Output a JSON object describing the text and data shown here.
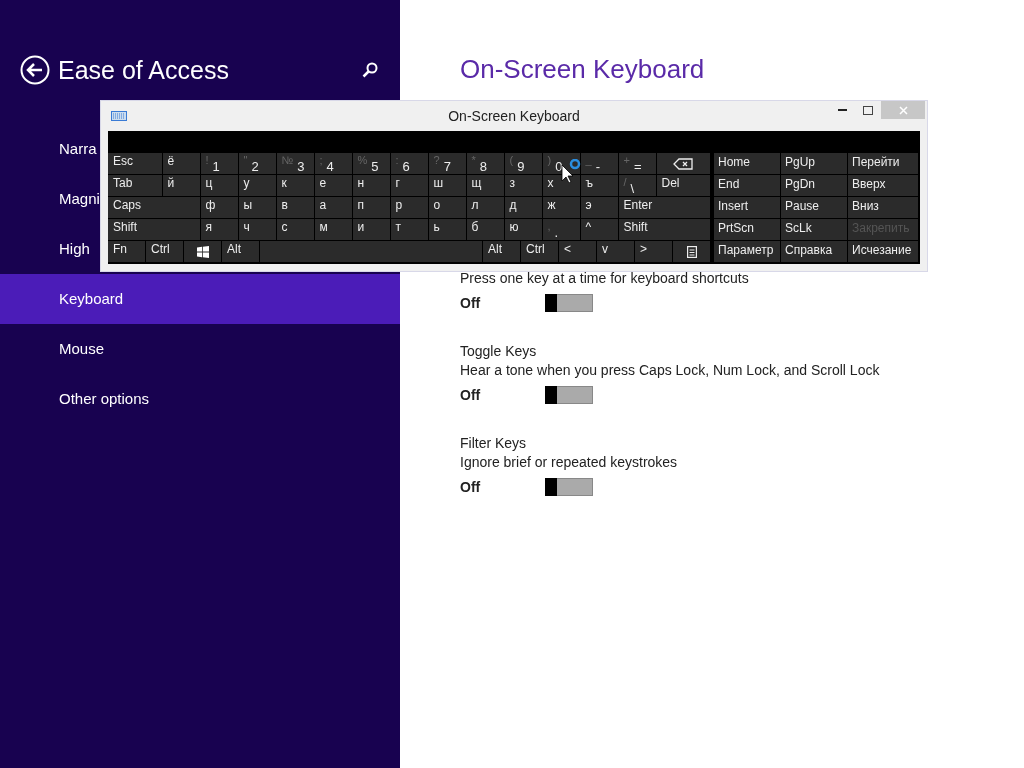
{
  "sidebar": {
    "title": "Ease of Access",
    "items": [
      {
        "label": "Narra",
        "selected": false
      },
      {
        "label": "Magni",
        "selected": false
      },
      {
        "label": "High",
        "selected": false
      },
      {
        "label": "Keyboard",
        "selected": true
      },
      {
        "label": "Mouse",
        "selected": false
      },
      {
        "label": "Other options",
        "selected": false
      }
    ]
  },
  "content": {
    "heading": "On-Screen Keyboard",
    "settings": [
      {
        "description": "Press one key at a time for keyboard shortcuts",
        "value": "Off",
        "on": false
      },
      {
        "title": "Toggle Keys",
        "description": "Hear a tone when you press Caps Lock, Num Lock, and Scroll Lock",
        "value": "Off",
        "on": false
      },
      {
        "title": "Filter Keys",
        "description": "Ignore brief or repeated keystrokes",
        "value": "Off",
        "on": false
      }
    ]
  },
  "osk": {
    "title": "On-Screen Keyboard",
    "rows": [
      [
        {
          "kind": "mod",
          "label": "Esc"
        },
        {
          "kind": "char",
          "label": "ё"
        },
        {
          "kind": "char",
          "shift": "!",
          "label": "1"
        },
        {
          "kind": "char",
          "shift": "\"",
          "label": "2"
        },
        {
          "kind": "char",
          "shift": "№",
          "label": "3"
        },
        {
          "kind": "char",
          "shift": ";",
          "label": "4"
        },
        {
          "kind": "char",
          "shift": "%",
          "label": "5"
        },
        {
          "kind": "char",
          "shift": ":",
          "label": "6"
        },
        {
          "kind": "char",
          "shift": "?",
          "label": "7"
        },
        {
          "kind": "char",
          "shift": "*",
          "label": "8"
        },
        {
          "kind": "char",
          "shift": "(",
          "label": "9"
        },
        {
          "kind": "char",
          "shift": ")",
          "label": "0"
        },
        {
          "kind": "char",
          "shift": "_",
          "label": "-"
        },
        {
          "kind": "char",
          "shift": "+",
          "label": "="
        },
        {
          "kind": "backspace"
        }
      ],
      [
        {
          "kind": "mod",
          "label": "Tab"
        },
        {
          "kind": "char",
          "label": "й"
        },
        {
          "kind": "char",
          "label": "ц"
        },
        {
          "kind": "char",
          "label": "у"
        },
        {
          "kind": "char",
          "label": "к"
        },
        {
          "kind": "char",
          "label": "е"
        },
        {
          "kind": "char",
          "label": "н"
        },
        {
          "kind": "char",
          "label": "г"
        },
        {
          "kind": "char",
          "label": "ш"
        },
        {
          "kind": "char",
          "label": "щ"
        },
        {
          "kind": "char",
          "label": "з"
        },
        {
          "kind": "char",
          "label": "х"
        },
        {
          "kind": "char",
          "label": "ъ"
        },
        {
          "kind": "char",
          "shift": "/",
          "label": "\\"
        },
        {
          "kind": "mod",
          "label": "Del"
        }
      ],
      [
        {
          "kind": "mod",
          "label": "Caps"
        },
        {
          "kind": "char",
          "label": "ф"
        },
        {
          "kind": "char",
          "label": "ы"
        },
        {
          "kind": "char",
          "label": "в"
        },
        {
          "kind": "char",
          "label": "а"
        },
        {
          "kind": "char",
          "label": "п"
        },
        {
          "kind": "char",
          "label": "р"
        },
        {
          "kind": "char",
          "label": "о"
        },
        {
          "kind": "char",
          "label": "л"
        },
        {
          "kind": "char",
          "label": "д"
        },
        {
          "kind": "char",
          "label": "ж"
        },
        {
          "kind": "char",
          "label": "э"
        },
        {
          "kind": "mod",
          "label": "Enter"
        }
      ],
      [
        {
          "kind": "mod",
          "label": "Shift"
        },
        {
          "kind": "char",
          "label": "я"
        },
        {
          "kind": "char",
          "label": "ч"
        },
        {
          "kind": "char",
          "label": "с"
        },
        {
          "kind": "char",
          "label": "м"
        },
        {
          "kind": "char",
          "label": "и"
        },
        {
          "kind": "char",
          "label": "т"
        },
        {
          "kind": "char",
          "label": "ь"
        },
        {
          "kind": "char",
          "label": "б"
        },
        {
          "kind": "char",
          "label": "ю"
        },
        {
          "kind": "char",
          "shift": ",",
          "label": "."
        },
        {
          "kind": "char",
          "label": "^"
        },
        {
          "kind": "mod",
          "label": "Shift"
        }
      ],
      [
        {
          "kind": "fixed",
          "label": "Fn"
        },
        {
          "kind": "fixed",
          "label": "Ctrl"
        },
        {
          "kind": "windows"
        },
        {
          "kind": "fixed",
          "label": "Alt"
        },
        {
          "kind": "space"
        },
        {
          "kind": "fixed",
          "label": "Alt"
        },
        {
          "kind": "fixed",
          "label": "Ctrl"
        },
        {
          "kind": "char",
          "label": "<"
        },
        {
          "kind": "char",
          "label": "v"
        },
        {
          "kind": "char",
          "label": ">"
        },
        {
          "kind": "menu"
        }
      ]
    ],
    "nav": [
      [
        {
          "label": "Home",
          "disabled": false
        },
        {
          "label": "PgUp",
          "disabled": false
        },
        {
          "label": "Перейти",
          "disabled": false
        }
      ],
      [
        {
          "label": "End",
          "disabled": false
        },
        {
          "label": "PgDn",
          "disabled": false
        },
        {
          "label": "Вверх",
          "disabled": false
        }
      ],
      [
        {
          "label": "Insert",
          "disabled": false
        },
        {
          "label": "Pause",
          "disabled": false
        },
        {
          "label": "Вниз",
          "disabled": false
        }
      ],
      [
        {
          "label": "PrtScn",
          "disabled": false
        },
        {
          "label": "ScLk",
          "disabled": false
        },
        {
          "label": "Закрепить",
          "disabled": true
        }
      ],
      [
        {
          "label": "Параметр",
          "disabled": false
        },
        {
          "label": "Справка",
          "disabled": false
        },
        {
          "label": "Исчезание",
          "disabled": false
        }
      ]
    ]
  }
}
